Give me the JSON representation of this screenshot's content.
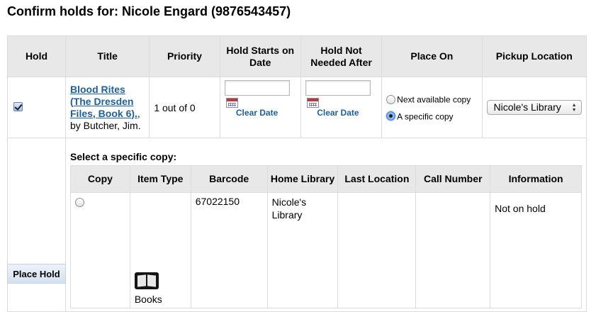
{
  "page": {
    "title": "Confirm holds for: Nicole Engard (9876543457)"
  },
  "holds_table": {
    "headers": {
      "hold": "Hold",
      "title": "Title",
      "priority": "Priority",
      "hold_starts_on_date": "Hold Starts on Date",
      "hold_not_needed_after": "Hold Not Needed After",
      "place_on": "Place On",
      "pickup_location": "Pickup Location"
    },
    "row": {
      "hold_checked": true,
      "title_link": "Blood Rites (The Dresden Files, Book 6).",
      "title_suffix": ",",
      "author": "by Butcher, Jim.",
      "priority": "1 out of 0",
      "start_date_value": "",
      "end_date_value": "",
      "clear_date_label": "Clear Date",
      "place_on_options": [
        "Next available copy",
        "A specific copy"
      ],
      "place_on_selected": "A specific copy",
      "pickup_location": "Nicole's Library"
    }
  },
  "copy_section": {
    "heading": "Select a specific copy:",
    "headers": {
      "copy": "Copy",
      "item_type": "Item Type",
      "barcode": "Barcode",
      "home_library": "Home Library",
      "last_location": "Last Location",
      "call_number": "Call Number",
      "information": "Information"
    },
    "rows": [
      {
        "selected": false,
        "item_type_icon": "book-icon",
        "item_type": "Books",
        "barcode": "67022150",
        "home_library": "Nicole's Library",
        "last_location": "",
        "call_number": "",
        "information": "Not on hold"
      }
    ]
  },
  "actions": {
    "place_hold_label": "Place Hold"
  }
}
